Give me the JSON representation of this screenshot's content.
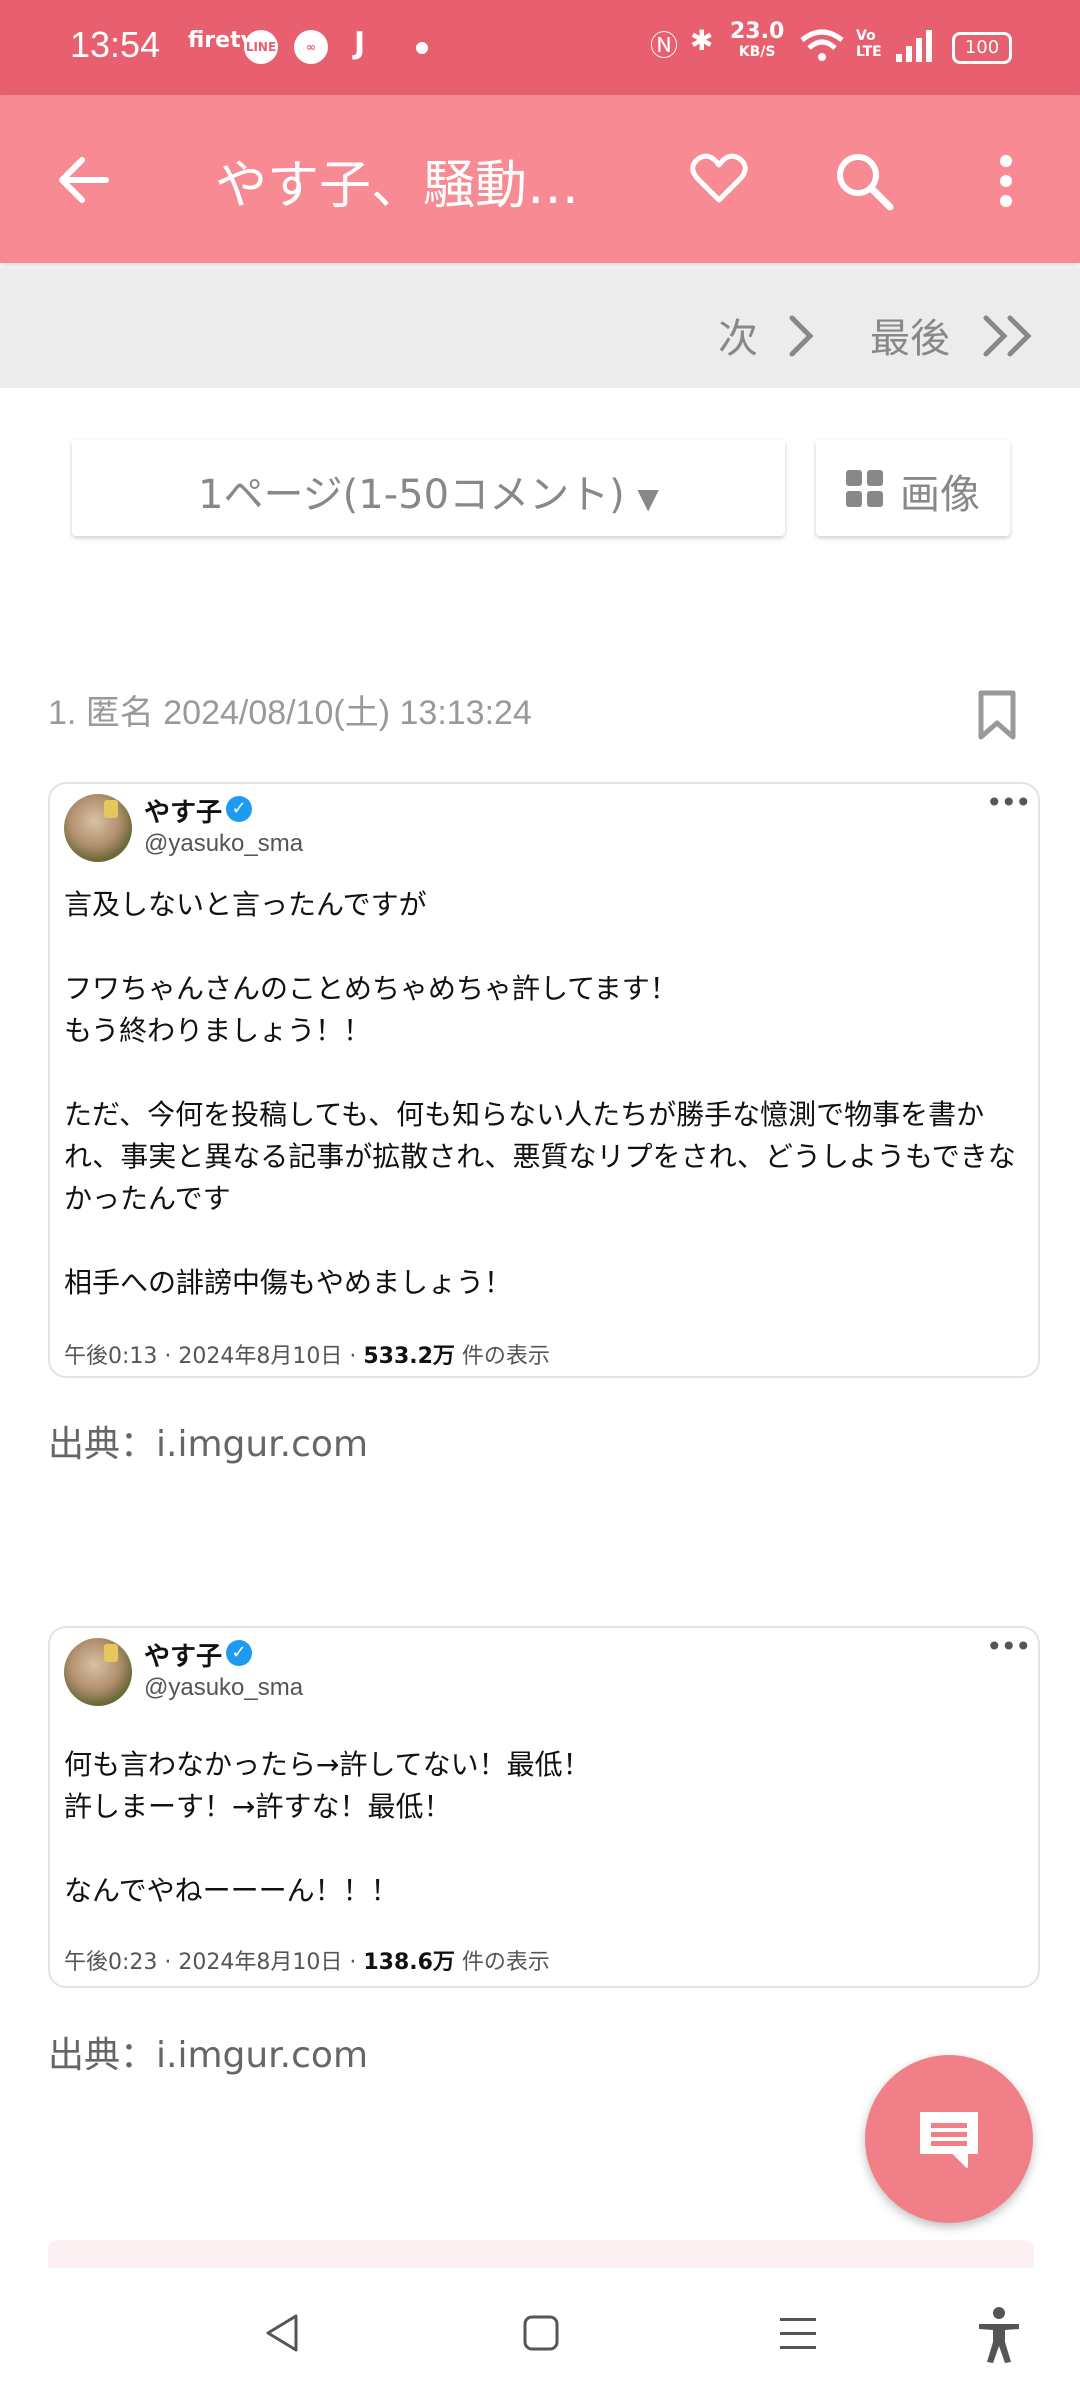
{
  "status_bar": {
    "time": "13:54",
    "apps": [
      "firetv",
      "LINE",
      "J"
    ],
    "net_speed_value": "23.0",
    "net_speed_unit": "KB/S",
    "battery": "100"
  },
  "toolbar": {
    "title": "やす子、騒動…",
    "icons": [
      "back-arrow-icon",
      "heart-icon",
      "search-icon",
      "more-vert-icon"
    ]
  },
  "pager": {
    "next_label": "次",
    "last_label": "最後"
  },
  "page_select": {
    "label": "1ページ(1-50コメント)",
    "images_label": "画像"
  },
  "comment": {
    "header": "1. 匿名 2024/08/10(土) 13:13:24"
  },
  "tweets": [
    {
      "name": "やす子",
      "handle": "@yasuko_sma",
      "text": "言及しないと言ったんですが\n\nフワちゃんさんのことめちゃめちゃ許してます！\nもう終わりましょう！！\n\nただ、今何を投稿しても、何も知らない人たちが勝手な憶測で物事を書かれ、事実と異なる記事が拡散され、悪質なリプをされ、どうしようもできなかったんです\n\n相手への誹謗中傷もやめましょう！",
      "meta_time": "午後0:13 · 2024年8月10日 · ",
      "meta_views": "533.2万",
      "meta_suffix": " 件の表示"
    },
    {
      "name": "やす子",
      "handle": "@yasuko_sma",
      "text": "何も言わなかったら→許してない！最低！\n許しまーす！→許すな！最低！\n\nなんでやねーーーん！！！",
      "meta_time": "午後0:23 · 2024年8月10日 · ",
      "meta_views": "138.6万",
      "meta_suffix": " 件の表示"
    }
  ],
  "sources": [
    "出典：i.imgur.com",
    "出典：i.imgur.com"
  ],
  "colors": {
    "status_bar": "#e8606f",
    "toolbar": "#f78a93",
    "fab": "#f07f88",
    "verified": "#1d9bf0"
  }
}
